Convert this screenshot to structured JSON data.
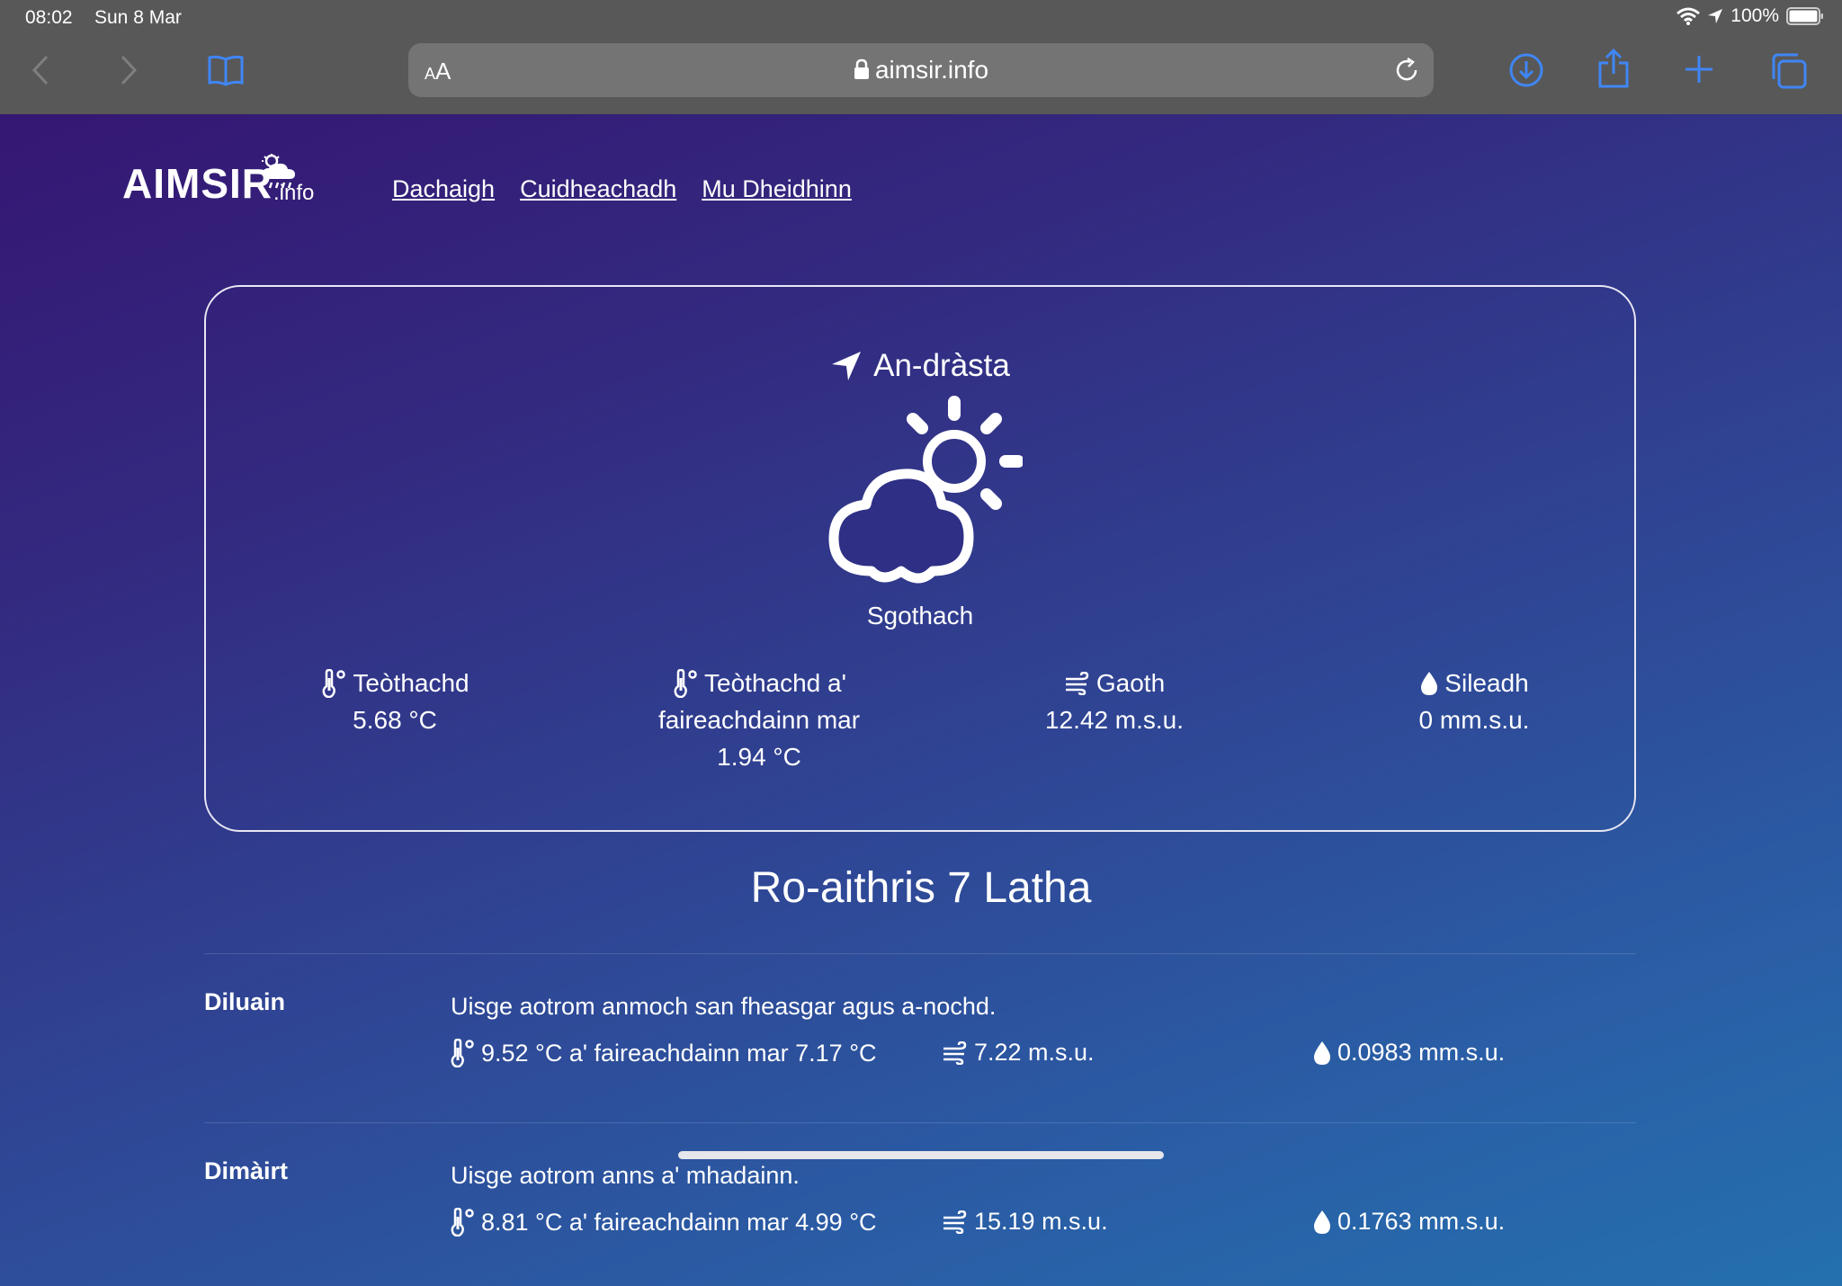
{
  "status_bar": {
    "time": "08:02",
    "date": "Sun 8 Mar",
    "battery": "100%"
  },
  "browser": {
    "url": "aimsir.info",
    "reader_label": "AA"
  },
  "site": {
    "logo_main": "AIMSIR",
    "logo_sub": ".info",
    "nav": [
      "Dachaigh",
      "Cuidheachadh",
      "Mu Dheidhinn"
    ]
  },
  "current": {
    "title": "An-dràsta",
    "condition": "Sgothach",
    "temp_label": "Teòthachd",
    "temp_value": "5.68 °C",
    "feels_label_1": "Teòthachd a'",
    "feels_label_2": "faireachdainn mar",
    "feels_value": "1.94 °C",
    "wind_label": "Gaoth",
    "wind_value": "12.42 m.s.u.",
    "rain_label": "Sileadh",
    "rain_value": "0 mm.s.u."
  },
  "forecast": {
    "title": "Ro-aithris 7 Latha",
    "days": [
      {
        "day": "Diluain",
        "desc": "Uisge aotrom anmoch san fheasgar agus a-nochd.",
        "temp": "9.52 °C a' faireachdainn mar 7.17 °C",
        "wind": "7.22 m.s.u.",
        "rain": "0.0983 mm.s.u."
      },
      {
        "day": "Dimàirt",
        "desc": "Uisge aotrom anns a' mhadainn.",
        "temp": "8.81 °C a' faireachdainn mar 4.99 °C",
        "wind": "15.19 m.s.u.",
        "rain": "0.1763 mm.s.u."
      }
    ]
  },
  "colors": {
    "toolbar": "#585858",
    "accent_blue": "#3f86f5",
    "bg_top": "#351773",
    "bg_bottom": "#2470ae"
  }
}
